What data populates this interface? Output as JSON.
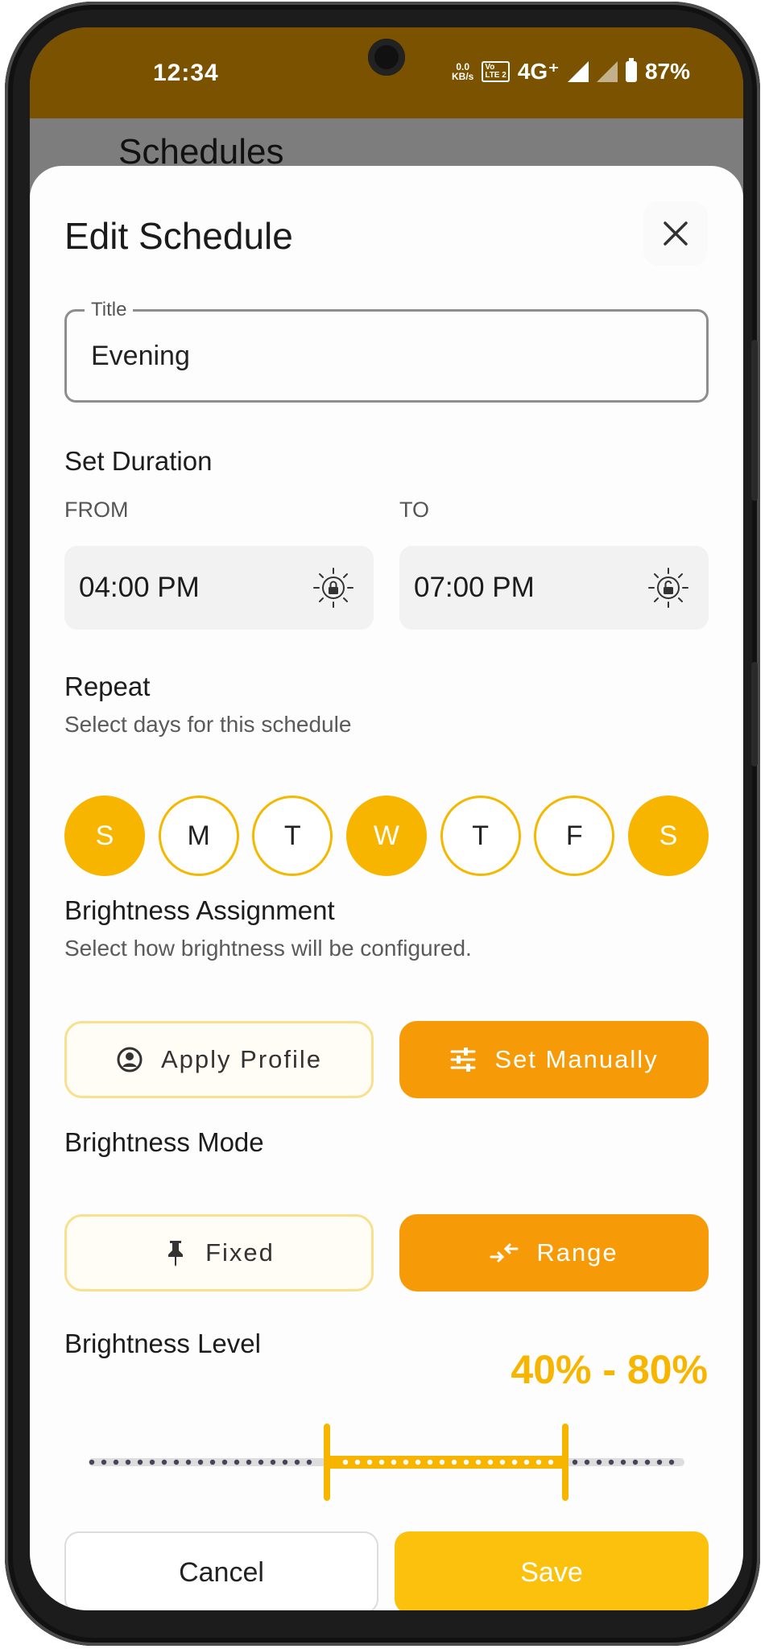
{
  "status_bar": {
    "time": "12:34",
    "data_rate": "0.0",
    "data_unit": "KB/s",
    "volte_line1": "Vo",
    "volte_line2": "LTE 2",
    "network": "4G⁺",
    "battery": "87%"
  },
  "background_screen_title": "Schedules",
  "sheet": {
    "title": "Edit Schedule",
    "close_icon": "close-icon"
  },
  "title_field": {
    "label": "Title",
    "value": "Evening"
  },
  "duration": {
    "heading": "Set Duration",
    "from_label": "FROM",
    "from_value": "04:00 PM",
    "to_label": "TO",
    "to_value": "07:00 PM",
    "from_icon": "sun-lock-icon",
    "to_icon": "sun-unlock-icon"
  },
  "repeat": {
    "heading": "Repeat",
    "subtitle": "Select days for this schedule",
    "days": [
      {
        "letter": "S",
        "selected": true
      },
      {
        "letter": "M",
        "selected": false
      },
      {
        "letter": "T",
        "selected": false
      },
      {
        "letter": "W",
        "selected": true
      },
      {
        "letter": "T",
        "selected": false
      },
      {
        "letter": "F",
        "selected": false
      },
      {
        "letter": "S",
        "selected": true
      }
    ]
  },
  "assignment": {
    "heading": "Brightness Assignment",
    "subtitle": "Select how brightness will be configured.",
    "apply_profile_label": "Apply Profile",
    "set_manually_label": "Set Manually",
    "selected": "Set Manually"
  },
  "mode": {
    "heading": "Brightness Mode",
    "fixed_label": "Fixed",
    "range_label": "Range",
    "selected": "Range"
  },
  "level": {
    "heading": "Brightness Level",
    "value_text": "40% - 80%",
    "min_percent": 40,
    "max_percent": 80
  },
  "actions": {
    "cancel_label": "Cancel",
    "save_label": "Save"
  },
  "colors": {
    "accent_yellow": "#f7b500",
    "accent_orange": "#f79a07",
    "status_bar": "#7a5200"
  }
}
